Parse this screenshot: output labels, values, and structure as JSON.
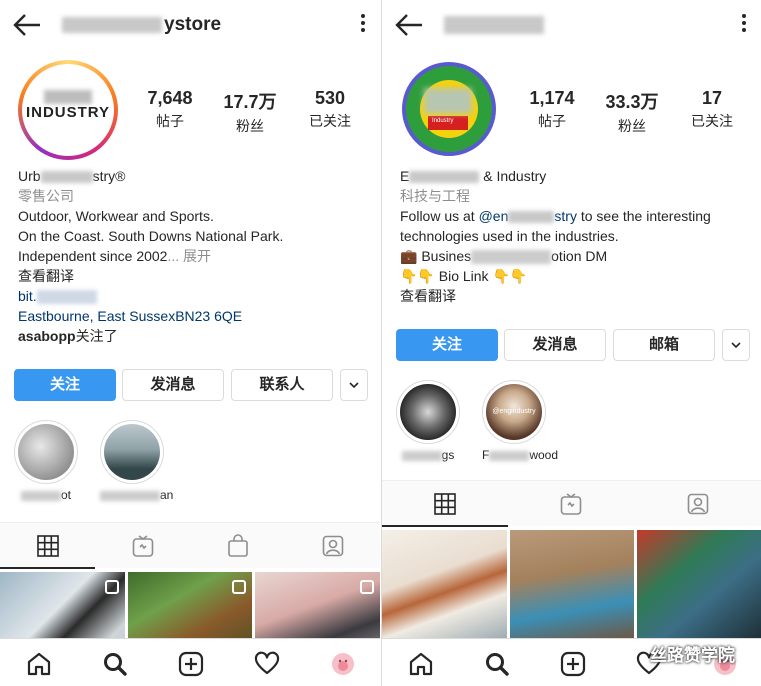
{
  "left": {
    "username_suffix": "ystore",
    "logo_text": "INDUSTRY",
    "stats": [
      {
        "num": "7,648",
        "label": "帖子"
      },
      {
        "num": "17.7万",
        "label": "粉丝"
      },
      {
        "num": "530",
        "label": "已关注"
      }
    ],
    "bio": {
      "name_prefix": "Urb",
      "name_suffix": "stry®",
      "category": "零售公司",
      "line1": "Outdoor, Workwear and Sports.",
      "line2": "On the Coast. South Downs National Park.",
      "line3": "Independent since 2002",
      "more": "... 展开",
      "translate": "查看翻译",
      "link_prefix": "bit.",
      "address": "Eastbourne, East SussexBN23 6QE",
      "followed_by_user": "asabopp",
      "followed_by_suffix": "关注了"
    },
    "buttons": {
      "follow": "关注",
      "message": "发消息",
      "contact": "联系人",
      "more": "⌄"
    },
    "highlights": [
      {
        "label_suffix": "ot"
      },
      {
        "label_suffix": "an"
      }
    ]
  },
  "right": {
    "stats": [
      {
        "num": "1,174",
        "label": "帖子"
      },
      {
        "num": "33.3万",
        "label": "粉丝"
      },
      {
        "num": "17",
        "label": "已关注"
      }
    ],
    "logo_text": "Industry",
    "bio": {
      "name_prefix": "E",
      "name_suffix": "& Industry",
      "category": "科技与工程",
      "follow_prefix": "Follow us at ",
      "mention_prefix": "@en",
      "mention_suffix": "stry",
      "follow_suffix": " to see the interesting",
      "line2": "technologies used in the industries.",
      "business_prefix": "💼 Busines",
      "business_suffix": "otion DM",
      "biolink": "👇👇 Bio Link 👇👇",
      "translate": "查看翻译"
    },
    "buttons": {
      "follow": "关注",
      "message": "发消息",
      "email": "邮箱",
      "more": "⌄"
    },
    "highlights": [
      {
        "label_suffix": "gs",
        "inner": ""
      },
      {
        "label_prefix": "F",
        "label_suffix": "wood",
        "inner": "@engindustry"
      }
    ]
  },
  "watermark": "丝路赞学院",
  "colors": {
    "accent": "#3897f0",
    "link": "#00376b",
    "muted": "#8e8e8e"
  }
}
